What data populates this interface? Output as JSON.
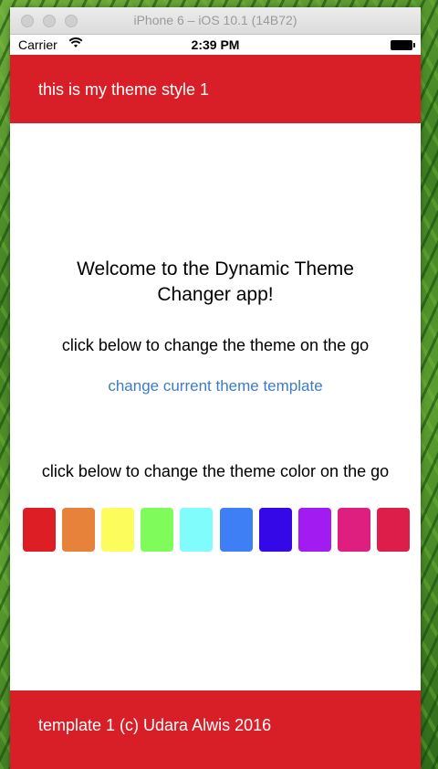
{
  "simulator": {
    "title": "iPhone 6 – iOS 10.1 (14B72)"
  },
  "status_bar": {
    "carrier": "Carrier",
    "time": "2:39 PM"
  },
  "header": {
    "title": "this is my theme style 1"
  },
  "main": {
    "welcome": "Welcome to the Dynamic Theme Changer app!",
    "instruction_template": "click below to change the theme on the go",
    "change_template_link": "change current theme template",
    "instruction_color": "click below to change the theme color on the go"
  },
  "swatches": [
    {
      "name": "red",
      "color": "#dd1e25"
    },
    {
      "name": "orange",
      "color": "#e7823a"
    },
    {
      "name": "yellow",
      "color": "#fcfc5c"
    },
    {
      "name": "green",
      "color": "#7ffc5c"
    },
    {
      "name": "cyan",
      "color": "#80fcfc"
    },
    {
      "name": "blue",
      "color": "#3f7ff5"
    },
    {
      "name": "indigo",
      "color": "#3508e8"
    },
    {
      "name": "purple",
      "color": "#a21bf0"
    },
    {
      "name": "magenta",
      "color": "#df1f7f"
    },
    {
      "name": "crimson",
      "color": "#dd1e4a"
    }
  ],
  "footer": {
    "text": "template 1 (c) Udara Alwis 2016"
  },
  "colors": {
    "theme_primary": "#d81e26",
    "link": "#3d7cc4"
  }
}
